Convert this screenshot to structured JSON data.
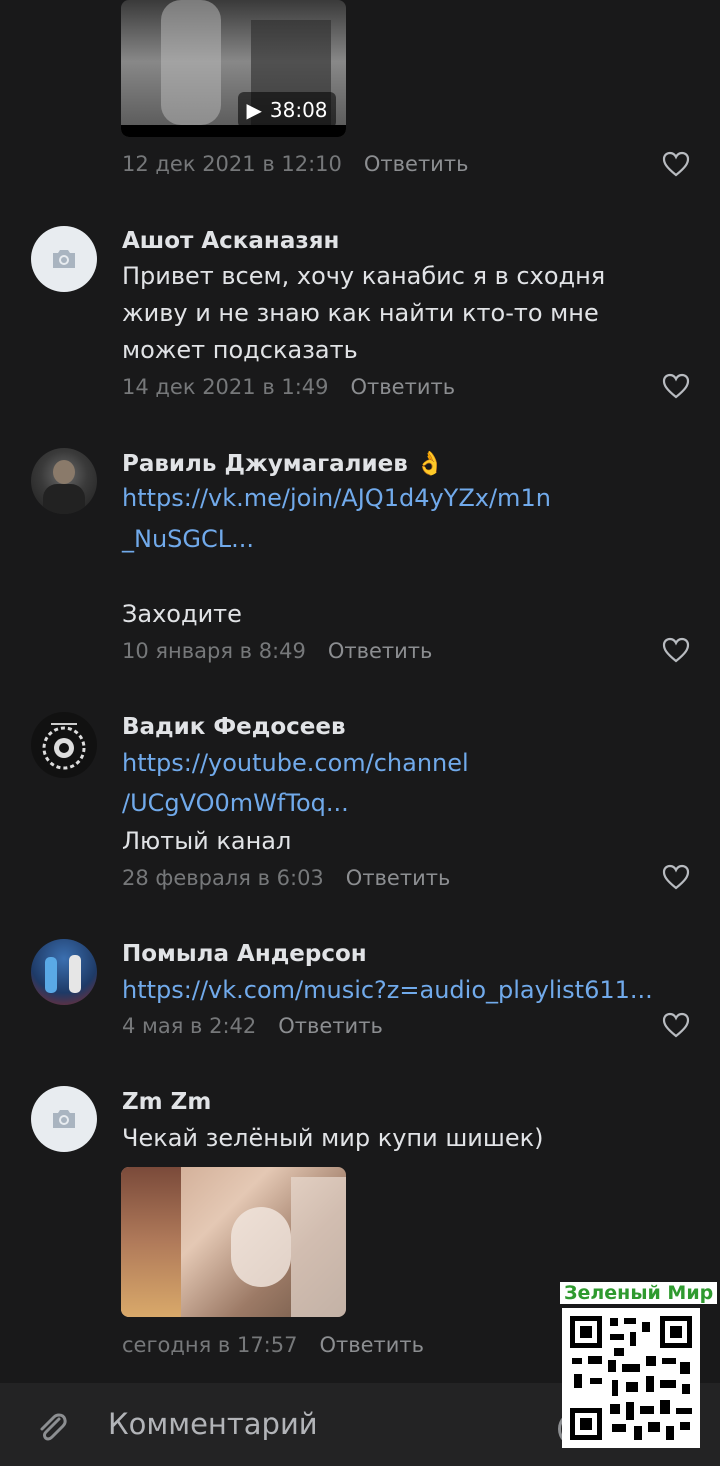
{
  "video": {
    "duration": "38:08"
  },
  "comments": [
    {
      "author": "",
      "text": "",
      "date": "12 дек 2021 в 12:10",
      "reply": "Ответить"
    },
    {
      "author": "Ашот Асканазян",
      "text_lines": [
        "Привет всем, хочу канабис я в сходня",
        "живу и не знаю как найти кто-то мне",
        "может подсказать"
      ],
      "date": "14 дек 2021 в 1:49",
      "reply": "Ответить"
    },
    {
      "author": "Равиль Джумагалиев 👌",
      "link_lines": [
        "https://vk.me/join/AJQ1d4yYZx/m1n",
        "_NuSGCL..."
      ],
      "text": "Заходите",
      "date": "10 января в 8:49",
      "reply": "Ответить"
    },
    {
      "author": "Вадик Федосеев",
      "link_lines": [
        "https://youtube.com/channel",
        "/UCgVO0mWfToq..."
      ],
      "text": "Лютый канал",
      "date": "28 февраля в 6:03",
      "reply": "Ответить"
    },
    {
      "author": "Помыла Андерсон",
      "link_lines": [
        "https://vk.com/music?z=audio_playlist611..."
      ],
      "date": "4 мая в 2:42",
      "reply": "Ответить"
    },
    {
      "author": "Zm Zm",
      "text": "Чекай зелёный мир купи шишек)",
      "date": "сегодня в 17:57",
      "reply": "Ответить"
    }
  ],
  "watermark": {
    "label": "Зеленый Мир"
  },
  "composer": {
    "placeholder": "Комментарий"
  },
  "colors": {
    "background": "#19191a",
    "link": "#71aaeb",
    "meta": "#76787a",
    "watermark_green": "#2f9a2f"
  }
}
